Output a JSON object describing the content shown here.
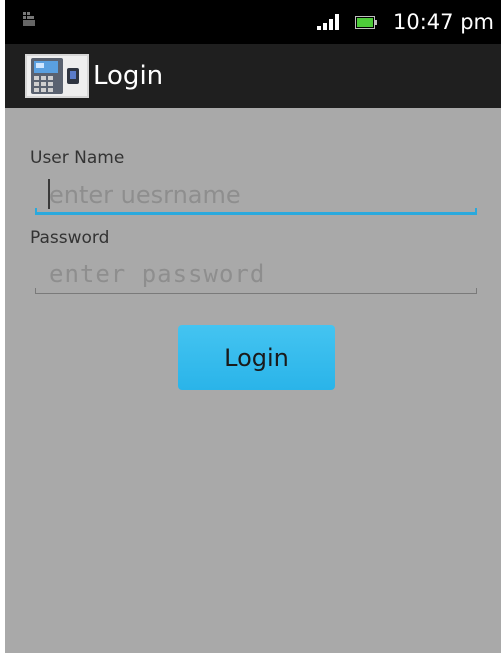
{
  "status_bar": {
    "time": "10:47 pm",
    "icons": [
      "notification-icon",
      "signal-icon",
      "battery-icon"
    ]
  },
  "action_bar": {
    "title": "Login",
    "app_icon": "attendance-device-icon"
  },
  "form": {
    "username": {
      "label": "User Name",
      "placeholder": "enter uesrname",
      "value": ""
    },
    "password": {
      "label": "Password",
      "placeholder": "enter password",
      "value": ""
    },
    "login_label": "Login"
  },
  "colors": {
    "status_bar_bg": "#000000",
    "action_bar_bg": "#1f1f1f",
    "content_bg": "#a9a9a9",
    "accent": "#2aa9dd",
    "button_bg": "#33bbee"
  }
}
